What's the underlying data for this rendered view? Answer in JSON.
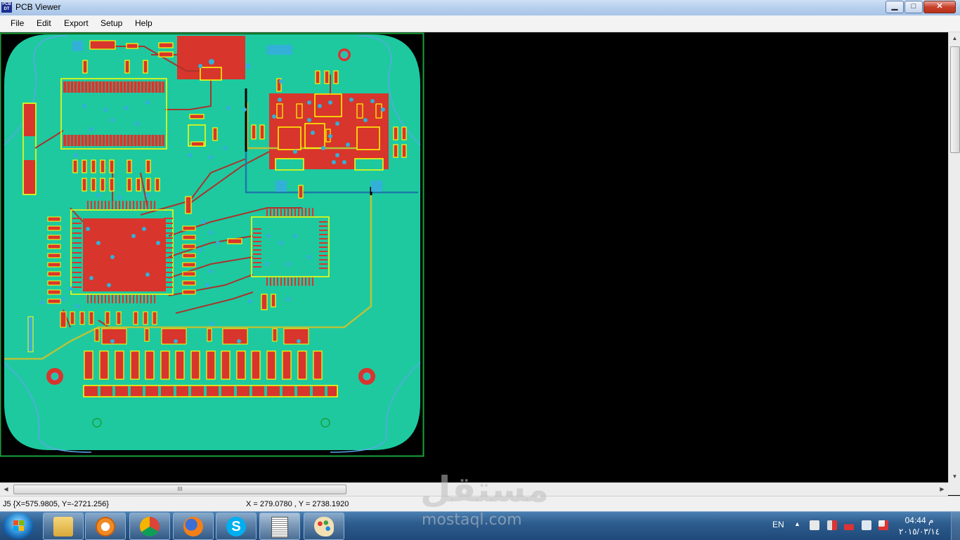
{
  "window": {
    "title": "PCB Viewer",
    "icon_text": "PCB DT",
    "buttons": {
      "minimize": "▁",
      "maximize": "□",
      "close": "✕"
    }
  },
  "menu": [
    "File",
    "Edit",
    "Export",
    "Setup",
    "Help"
  ],
  "canvas": {
    "colors": {
      "board": "#1ec9a0",
      "copper": "#d8352c",
      "silk": "#ffff00",
      "pad": "#33b0d8",
      "outline": "#1aa03a",
      "background": "#000000"
    }
  },
  "status": {
    "left": "J5 {X=575.9805, Y=-2721.256}",
    "center": "X = 279.0780 , Y = 2738.1920"
  },
  "scrollbar": {
    "grip": "III"
  },
  "taskbar": {
    "apps": [
      "windows-explorer",
      "media-player",
      "chrome",
      "firefox",
      "skype",
      "document-viewer",
      "paint"
    ],
    "lang": "EN",
    "arrow": "▲",
    "time": "04:44 م",
    "date": "٢٠١٥/٠٣/١٤"
  },
  "watermark": {
    "arabic": "مستقل",
    "latin": "mostaql.com"
  }
}
